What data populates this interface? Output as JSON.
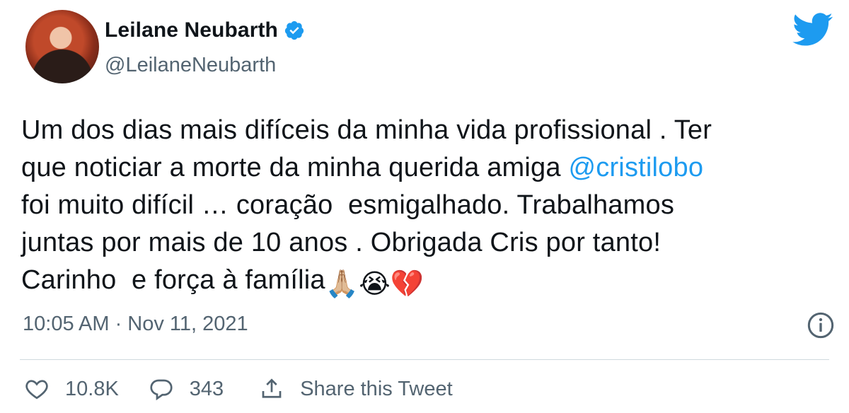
{
  "author": {
    "display_name": "Leilane Neubarth",
    "handle": "@LeilaneNeubarth",
    "verified_icon": "verified-badge-icon"
  },
  "brand": {
    "logo_icon": "twitter-bird-icon",
    "color": "#1d9bf0"
  },
  "tweet": {
    "lines": [
      {
        "text": "Um dos dias mais difíceis da minha vida profissional . Ter"
      },
      {
        "before": "que noticiar a morte da minha querida amiga ",
        "mention": "@cristilobo"
      },
      {
        "text": "foi muito difícil … coração  esmigalhado. Trabalhamos"
      },
      {
        "text": "juntas por mais de 10 anos . Obrigada Cris por tanto!"
      },
      {
        "text": "Carinho  e força à família"
      }
    ],
    "emojis": [
      "🙏🏼",
      "😭",
      "💔"
    ],
    "timestamp": "10:05 AM · Nov 11, 2021"
  },
  "actions": {
    "like_count": "10.8K",
    "reply_count": "343",
    "share_label": "Share this Tweet"
  },
  "colors": {
    "text": "#0f1419",
    "secondary": "#536471",
    "link": "#1d9bf0",
    "divider": "#cfd9de"
  }
}
